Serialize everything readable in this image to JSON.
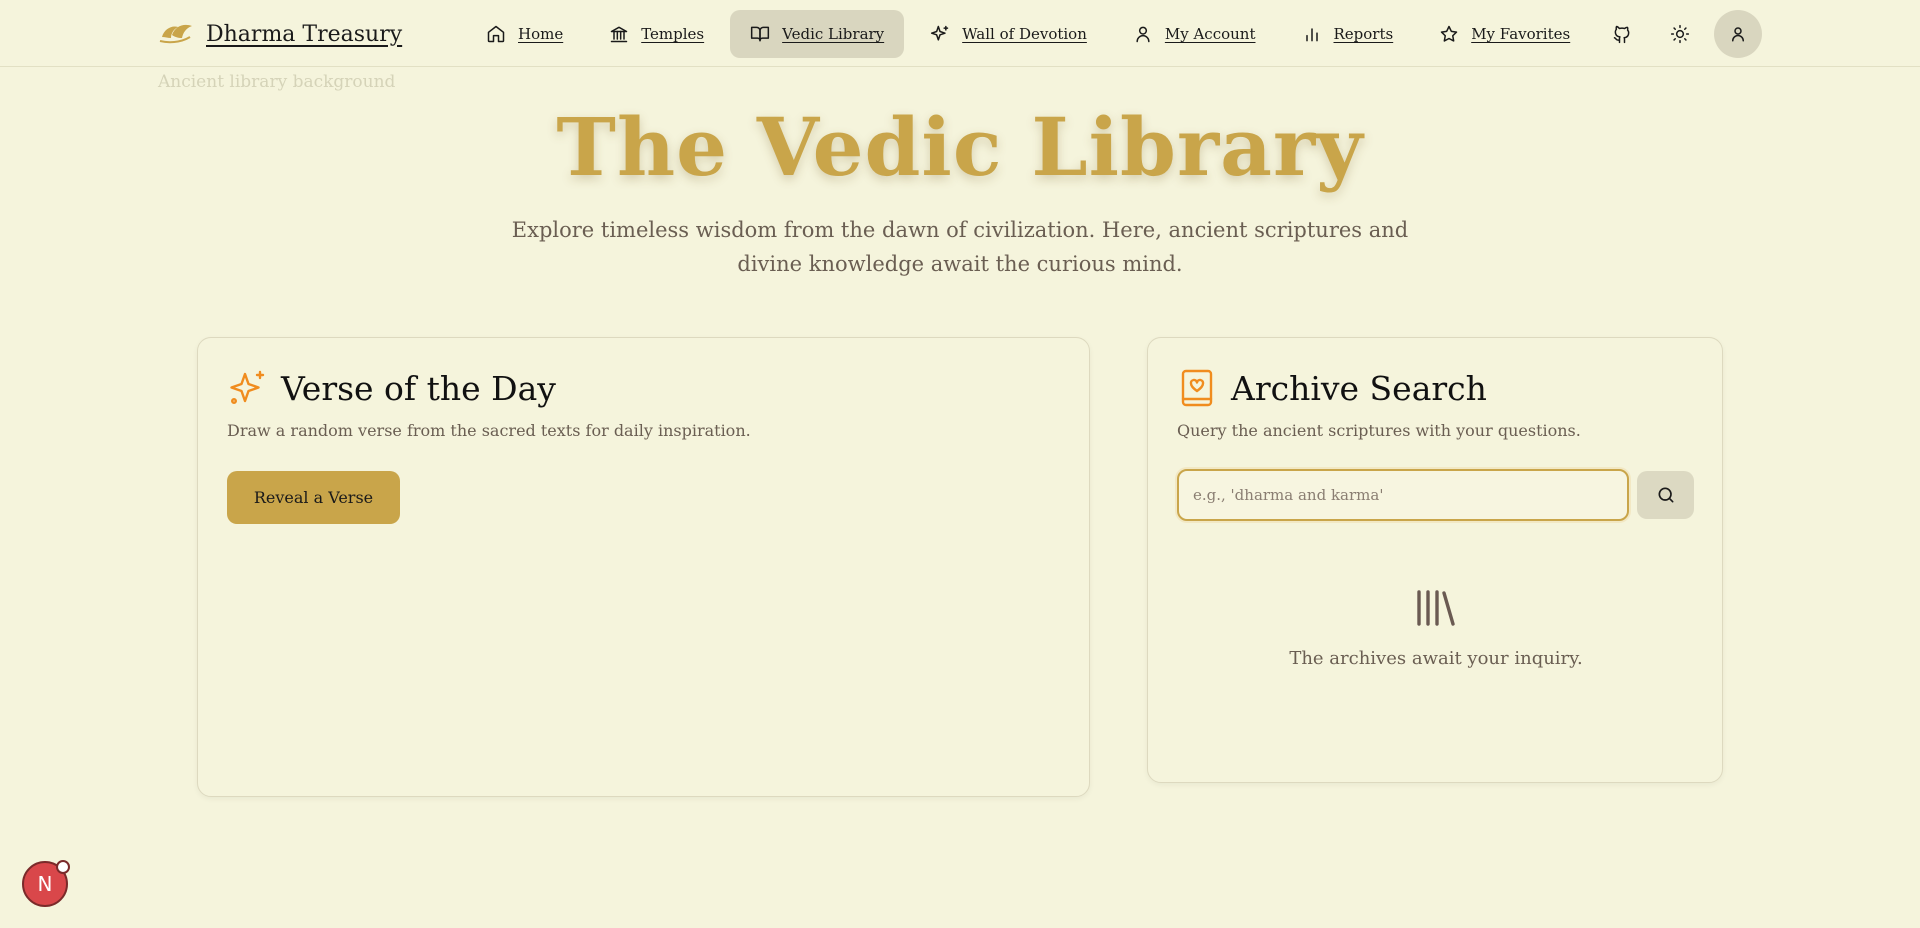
{
  "header": {
    "brand": "Dharma Treasury",
    "nav": [
      {
        "label": "Home",
        "icon": "home-icon"
      },
      {
        "label": "Temples",
        "icon": "temple-icon"
      },
      {
        "label": "Vedic Library",
        "icon": "book-open-icon",
        "active": true
      },
      {
        "label": "Wall of Devotion",
        "icon": "sparkles-icon"
      },
      {
        "label": "My Account",
        "icon": "user-icon"
      },
      {
        "label": "Reports",
        "icon": "bar-chart-icon"
      },
      {
        "label": "My Favorites",
        "icon": "star-icon"
      }
    ],
    "icons": [
      "github-icon",
      "sun-icon",
      "user-icon"
    ]
  },
  "background_alt": "Ancient library background",
  "hero": {
    "title": "The Vedic Library",
    "subtitle": "Explore timeless wisdom from the dawn of civilization. Here, ancient scriptures and divine knowledge await the curious mind."
  },
  "verse_card": {
    "title": "Verse of the Day",
    "description": "Draw a random verse from the sacred texts for daily inspiration.",
    "button": "Reveal a Verse"
  },
  "archive_card": {
    "title": "Archive Search",
    "description": "Query the ancient scriptures with your questions.",
    "search_placeholder": "e.g., 'dharma and karma'",
    "search_value": "",
    "empty_text": "The archives await your inquiry."
  },
  "float_badge": "N",
  "colors": {
    "background": "#f5f4dc",
    "gold": "#c9a54a",
    "accent_orange": "#f08c1e",
    "active_nav": "#d9d6bf",
    "badge_red": "#d9474a"
  }
}
